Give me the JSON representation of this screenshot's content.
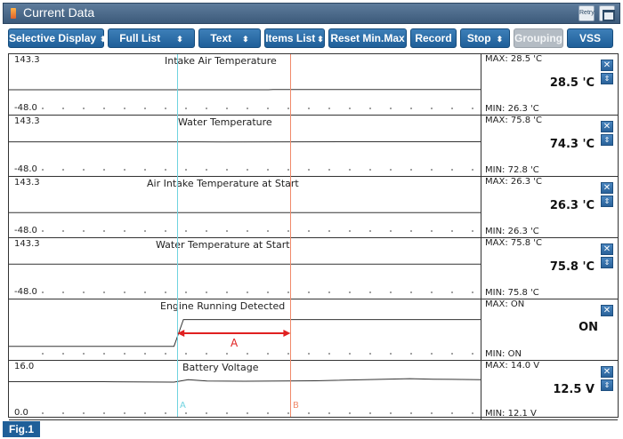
{
  "window": {
    "title": "Current Data",
    "retry_label": "Retry"
  },
  "toolbar": {
    "buttons": [
      {
        "label": "Selective Display",
        "dropdown": true,
        "disabled": false
      },
      {
        "label": "Full List",
        "dropdown": true,
        "disabled": false
      },
      {
        "label": "Text",
        "dropdown": true,
        "disabled": false
      },
      {
        "label": "Items List",
        "dropdown": true,
        "disabled": false
      },
      {
        "label": "Reset Min.Max",
        "dropdown": false,
        "disabled": false
      },
      {
        "label": "Record",
        "dropdown": false,
        "disabled": false
      },
      {
        "label": "Stop",
        "dropdown": true,
        "disabled": false
      },
      {
        "label": "Grouping",
        "dropdown": false,
        "disabled": true
      },
      {
        "label": "VSS",
        "dropdown": false,
        "disabled": false
      }
    ]
  },
  "graphs": [
    {
      "title": "Intake Air Temperature",
      "y_max": "143.3",
      "y_min": "-48.0",
      "max": "MAX:  28.5 'C",
      "min": "MIN:  26.3 'C",
      "current": "28.5 'C",
      "ymin": -48.0,
      "ymax": 143.3,
      "trace": [
        [
          0,
          27.5
        ],
        [
          0.55,
          27.5
        ],
        [
          0.56,
          28.5
        ],
        [
          1,
          28.5
        ]
      ]
    },
    {
      "title": "Water Temperature",
      "y_max": "143.3",
      "y_min": "-48.0",
      "max": "MAX:  75.8 'C",
      "min": "MIN:  72.8 'C",
      "current": "74.3 'C",
      "ymin": -48.0,
      "ymax": 143.3,
      "trace": [
        [
          0,
          74.0
        ],
        [
          0.4,
          74.0
        ],
        [
          0.45,
          73.5
        ],
        [
          0.6,
          73.8
        ],
        [
          0.8,
          74.2
        ],
        [
          1,
          74.3
        ]
      ]
    },
    {
      "title": "Air Intake Temperature at Start",
      "y_max": "143.3",
      "y_min": "-48.0",
      "max": "MAX:  26.3 'C",
      "min": "MIN:  26.3 'C",
      "current": "26.3 'C",
      "ymin": -48.0,
      "ymax": 143.3,
      "trace": [
        [
          0,
          26.3
        ],
        [
          1,
          26.3
        ]
      ]
    },
    {
      "title": "Water Temperature at Start",
      "y_max": "143.3",
      "y_min": "-48.0",
      "max": "MAX:  75.8 'C",
      "min": "MIN:  75.8 'C",
      "current": "75.8 'C",
      "ymin": -48.0,
      "ymax": 143.3,
      "trace": [
        [
          0,
          75.8
        ],
        [
          1,
          75.8
        ]
      ]
    },
    {
      "title": "Engine Running Detected",
      "y_max": "",
      "y_min": "",
      "max": "MAX:  ON",
      "min": "MIN:  ON",
      "current": "ON",
      "ymin": 0,
      "ymax": 1,
      "trace": [
        [
          0,
          0.1
        ],
        [
          0.35,
          0.1
        ],
        [
          0.37,
          0.8
        ],
        [
          1,
          0.8
        ]
      ]
    },
    {
      "title": "Battery Voltage",
      "y_max": "16.0",
      "y_min": "0.0",
      "max": "MAX:  14.0 V",
      "min": "MIN:  12.1 V",
      "current": "12.5 V",
      "ymin": 0,
      "ymax": 16,
      "trace": [
        [
          0,
          12.3
        ],
        [
          0.2,
          12.3
        ],
        [
          0.35,
          12.1
        ],
        [
          0.38,
          13.2
        ],
        [
          0.42,
          12.6
        ],
        [
          0.5,
          12.5
        ],
        [
          0.65,
          12.7
        ],
        [
          0.85,
          13.6
        ],
        [
          0.9,
          13.4
        ],
        [
          1,
          13.2
        ]
      ]
    }
  ],
  "cursors": {
    "a": {
      "label": "A",
      "position": 0.357,
      "color": "#6fd3e0"
    },
    "b": {
      "label": "B",
      "position": 0.597,
      "color": "#f08a6a"
    },
    "interval_label": "A",
    "interval_color": "#e02020"
  },
  "figure_label": "Fig.1"
}
